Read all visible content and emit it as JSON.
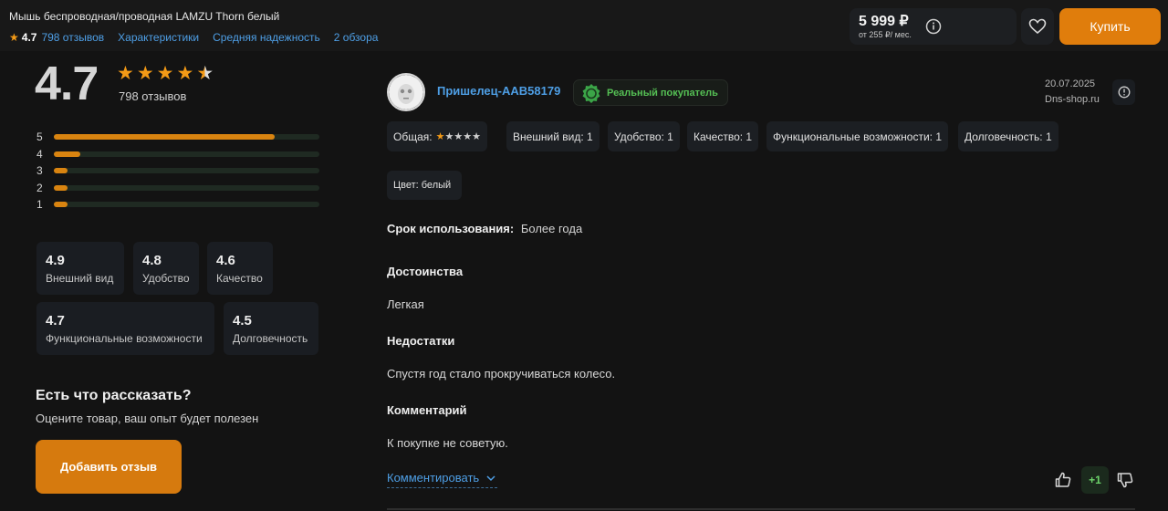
{
  "header": {
    "product_title": "Мышь беспроводная/проводная LAMZU Thorn белый",
    "rating": "4.7",
    "reviews_link": "798 отзывов",
    "specs_link": "Характеристики",
    "reliability_link": "Средняя надежность",
    "overviews_link": "2 обзора",
    "price": "5 999 ₽",
    "credit": "от 255 ₽/ мес.",
    "buy_label": "Купить"
  },
  "summary": {
    "rating": "4.7",
    "stars_value": 4.5,
    "reviews_count": "798 отзывов",
    "distribution": [
      {
        "label": "5",
        "fraction": 0.83
      },
      {
        "label": "4",
        "fraction": 0.1
      },
      {
        "label": "3",
        "fraction": 0.05
      },
      {
        "label": "2",
        "fraction": 0.05
      },
      {
        "label": "1",
        "fraction": 0.05
      }
    ],
    "scores": [
      {
        "value": "4.9",
        "label": "Внешний вид"
      },
      {
        "value": "4.8",
        "label": "Удобство"
      },
      {
        "value": "4.6",
        "label": "Качество"
      },
      {
        "value": "4.7",
        "label": "Функциональные возможности"
      },
      {
        "value": "4.5",
        "label": "Долговечность"
      }
    ],
    "tell_title": "Есть что рассказать?",
    "tell_subtitle": "Оцените товар, ваш опыт будет полезен",
    "add_review_label": "Добавить отзыв"
  },
  "review": {
    "author": "Пришелец-AAB58179",
    "badge": "Реальный покупатель",
    "date": "20.07.2025",
    "shop": "Dns-shop.ru",
    "overall_label": "Общая:",
    "overall_stars": 1,
    "chips": [
      "Внешний вид: 1",
      "Удобство: 1",
      "Качество: 1",
      "Функциональные возможности: 1",
      "Долговечность: 1"
    ],
    "color": "Цвет: белый",
    "usage_label": "Срок использования:",
    "usage_value": "Более года",
    "pros_title": "Достоинства",
    "pros": "Легкая",
    "cons_title": "Недостатки",
    "cons": "Спустя год стало прокручиваться колесо.",
    "comment_title": "Комментарий",
    "comment": "К покупке не советую.",
    "comment_link": "Комментировать",
    "votes": "+1"
  },
  "colors": {
    "accent": "#e07d0c",
    "link": "#4e9fe6",
    "star": "#f39a16",
    "positive": "#55c054"
  }
}
